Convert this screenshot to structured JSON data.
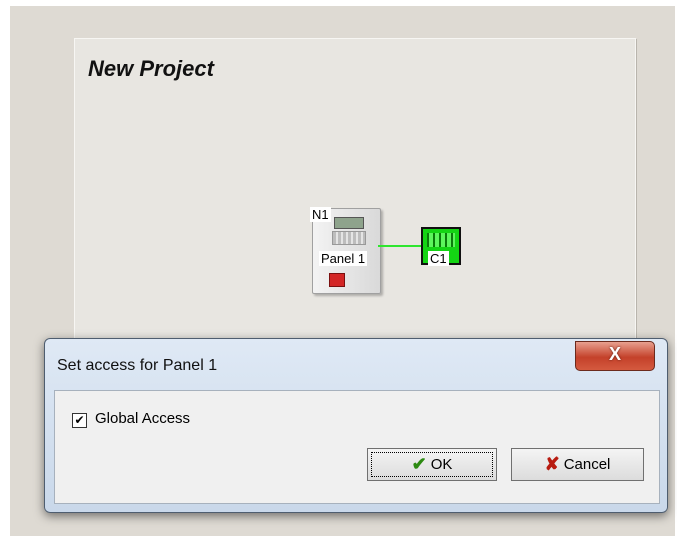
{
  "canvas": {
    "title": "New Project",
    "nodes": {
      "panel_id": "N1",
      "panel_name": "Panel 1",
      "loop_id": "C1"
    },
    "connector_color": "#2ee62e"
  },
  "dialog": {
    "title": "Set access for Panel 1",
    "close_label": "X",
    "checkbox": {
      "label": "Global Access",
      "checked": true,
      "mark": "✔"
    },
    "ok_icon": "check-icon",
    "ok_glyph": "✔",
    "ok_label": "OK",
    "cancel_icon": "x-icon",
    "cancel_glyph": "✘",
    "cancel_label": "Cancel"
  }
}
